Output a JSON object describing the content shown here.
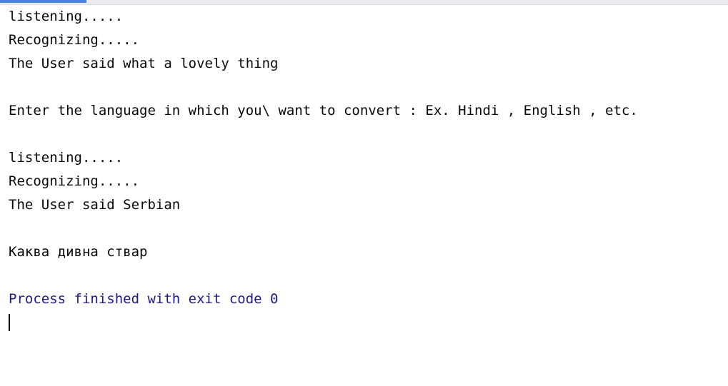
{
  "console": {
    "lines": [
      "listening.....",
      "Recognizing.....",
      "The User said what a lovely thing",
      "",
      "Enter the language in which you\\ want to convert : Ex. Hindi , English , etc.",
      "",
      "listening.....",
      "Recognizing.....",
      "The User said Serbian",
      "",
      "Каква дивна ствар",
      ""
    ],
    "process_message": "Process finished with exit code 0"
  },
  "colors": {
    "output_text": "#080808",
    "process_text": "#1a1a8c",
    "background": "#ffffff",
    "tab_accent": "#4a84e0"
  }
}
